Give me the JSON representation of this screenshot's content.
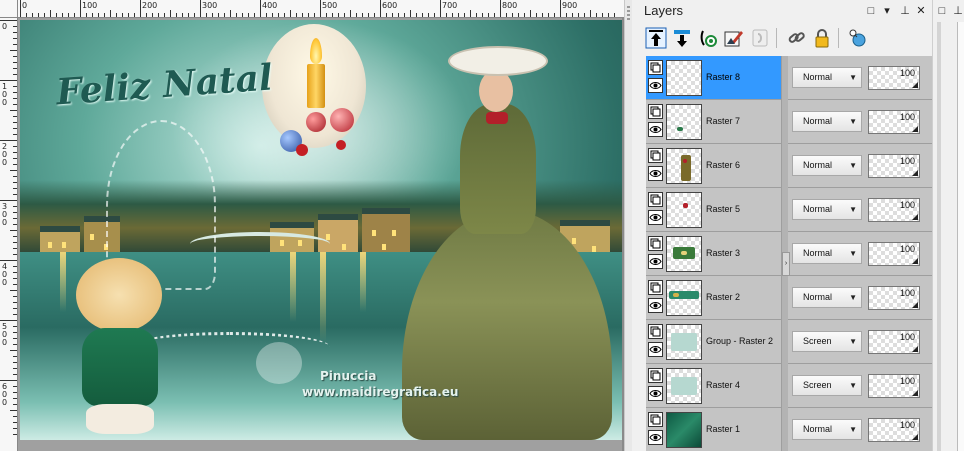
{
  "canvas": {
    "ruler_h_labels": [
      "0",
      "100",
      "200",
      "300",
      "400",
      "500",
      "600",
      "700",
      "800",
      "900"
    ],
    "ruler_v_labels": [
      "0",
      "100",
      "200",
      "300",
      "400",
      "500",
      "600"
    ],
    "artwork": {
      "title_text": "Feliz Natal",
      "watermark_line1": "Pinuccia",
      "watermark_line2": "www.maidiregrafica.eu"
    }
  },
  "layers_panel": {
    "title": "Layers",
    "header_buttons": {
      "restore": "□",
      "dropdown": "▾",
      "pin": "⊥",
      "close": "✕"
    },
    "toolbar_icons": [
      "move-up-icon",
      "move-down-icon",
      "properties-icon",
      "edit-icon",
      "mask-icon",
      "link-icon",
      "lock-icon",
      "view-icon"
    ],
    "layers": [
      {
        "name": "Raster 8",
        "blend": "Normal",
        "opacity": "100",
        "selected": true,
        "thumb": "empty"
      },
      {
        "name": "Raster 7",
        "blend": "Normal",
        "opacity": "100",
        "selected": false,
        "thumb": "small"
      },
      {
        "name": "Raster 6",
        "blend": "Normal",
        "opacity": "100",
        "selected": false,
        "thumb": "figure"
      },
      {
        "name": "Raster 5",
        "blend": "Normal",
        "opacity": "100",
        "selected": false,
        "thumb": "dot"
      },
      {
        "name": "Raster 3",
        "blend": "Normal",
        "opacity": "100",
        "selected": false,
        "thumb": "green"
      },
      {
        "name": "Raster 2",
        "blend": "Normal",
        "opacity": "100",
        "selected": false,
        "thumb": "wide"
      },
      {
        "name": "Group - Raster 2",
        "blend": "Screen",
        "opacity": "100",
        "selected": false,
        "thumb": "faint"
      },
      {
        "name": "Raster 4",
        "blend": "Screen",
        "opacity": "100",
        "selected": false,
        "thumb": "faint"
      },
      {
        "name": "Raster 1",
        "blend": "Normal",
        "opacity": "100",
        "selected": false,
        "thumb": "filled"
      }
    ]
  },
  "side_panel": {
    "restore": "□",
    "pin": "⊥"
  },
  "colors": {
    "selected_row": "#3399ff",
    "row_bg": "#c4c4c4",
    "panel_bg": "#f0f0f0"
  }
}
